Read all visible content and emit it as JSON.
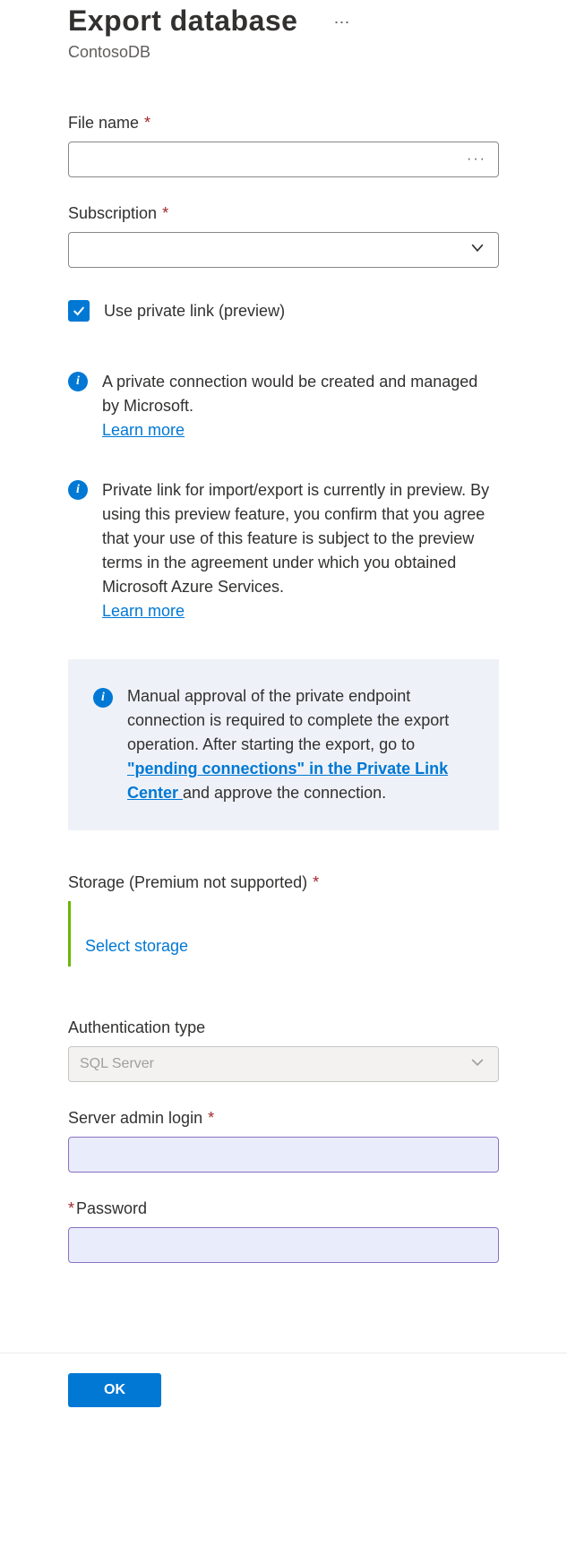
{
  "header": {
    "title": "Export database",
    "subtitle": "ContosoDB"
  },
  "fields": {
    "fileName": {
      "label": "File name",
      "value": ""
    },
    "subscription": {
      "label": "Subscription",
      "value": ""
    },
    "privateLinkCheckbox": {
      "label": "Use private link (preview)",
      "checked": true
    },
    "storage": {
      "label": "Storage (Premium not supported)",
      "selectLabel": "Select storage"
    },
    "authType": {
      "label": "Authentication type",
      "value": "SQL Server"
    },
    "adminLogin": {
      "label": "Server admin login",
      "value": ""
    },
    "password": {
      "label": "Password",
      "value": ""
    }
  },
  "info": {
    "conn": {
      "text": "A private connection would be created and managed by Microsoft.",
      "link": "Learn more"
    },
    "preview": {
      "text": "Private link for import/export is currently in preview. By using this preview feature, you confirm that you agree that your use of this feature is subject to the preview terms in the agreement under which you obtained Microsoft Azure Services.",
      "link": "Learn more"
    },
    "callout": {
      "pre": "Manual approval of the private endpoint connection is required to complete the export operation. After starting the export, go to ",
      "link": "\"pending connections\" in the Private Link Center ",
      "post": "and approve the connection."
    }
  },
  "footer": {
    "ok": "OK"
  }
}
